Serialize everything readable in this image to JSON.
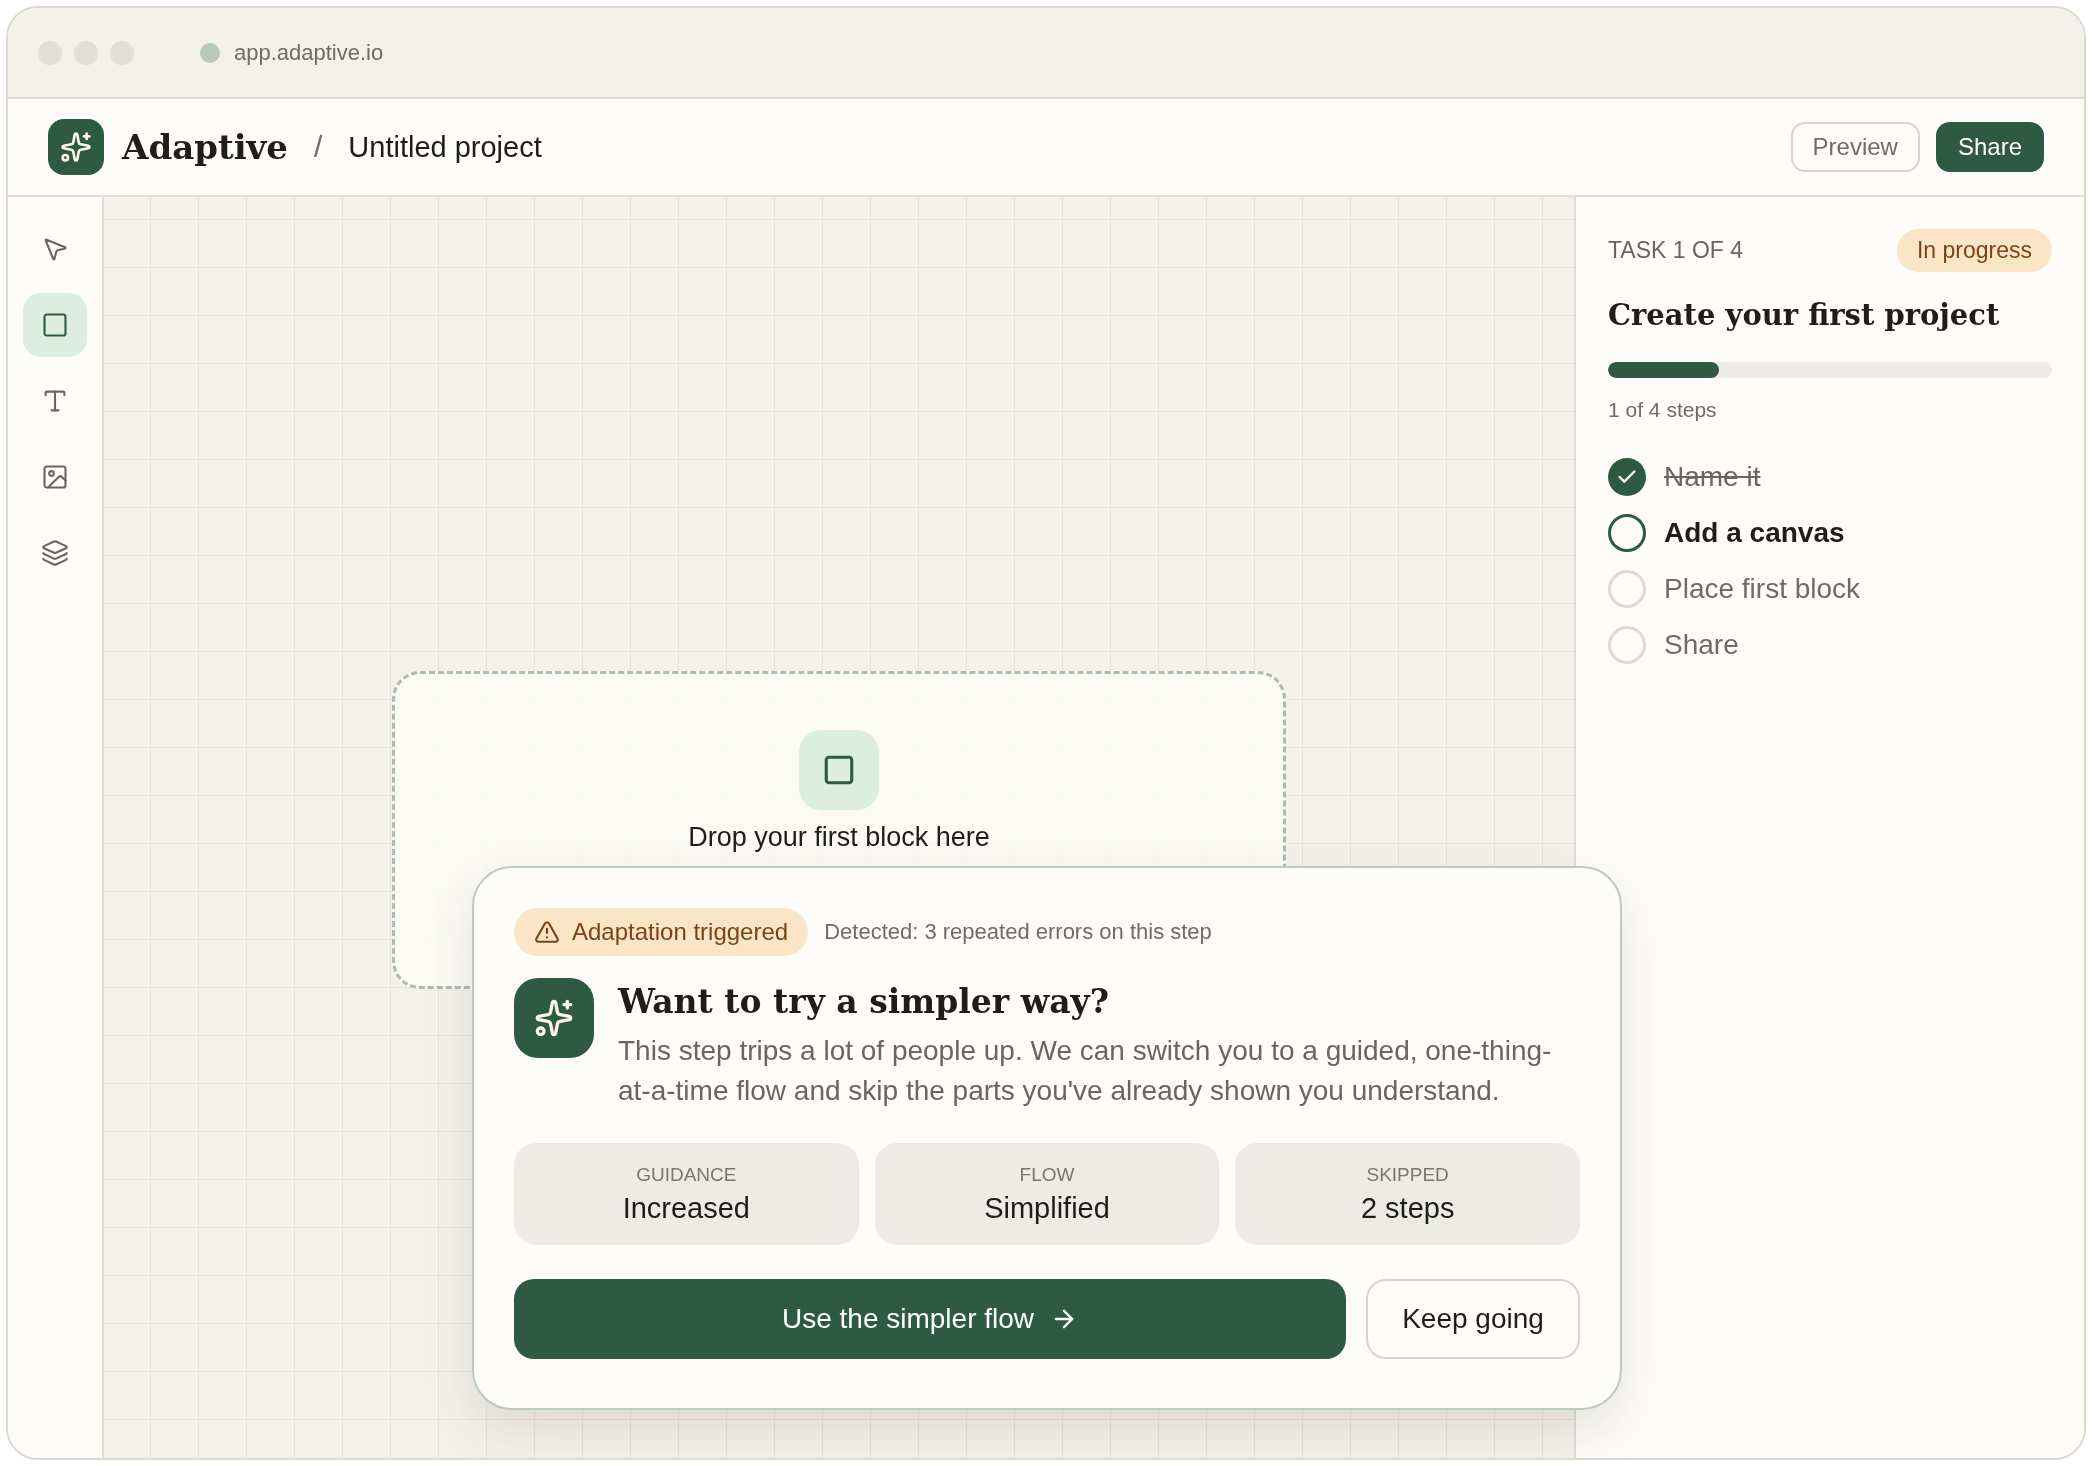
{
  "browser": {
    "url": "app.adaptive.io"
  },
  "header": {
    "brand": "Adaptive",
    "separator": "/",
    "project": "Untitled project",
    "buttons": [
      {
        "label": "Preview",
        "kind": "secondary"
      },
      {
        "label": "Share",
        "kind": "primary"
      }
    ]
  },
  "tools": [
    {
      "kind": "pointer",
      "selected": false
    },
    {
      "kind": "rectangle",
      "selected": true
    },
    {
      "kind": "text",
      "selected": false
    },
    {
      "kind": "image",
      "selected": false
    },
    {
      "kind": "layers",
      "selected": false
    }
  ],
  "canvas": {
    "drop_zone": {
      "label": "Drop your first block here"
    }
  },
  "task_panel": {
    "counter": "TASK 1 OF 4",
    "status": "In progress",
    "title": "Create your first project",
    "level": 0.25,
    "steps_label": "1 of 4 steps",
    "steps": [
      {
        "label": "Name it",
        "kind": "done"
      },
      {
        "label": "Add a canvas",
        "kind": "current"
      },
      {
        "label": "Place first block",
        "kind": "pending"
      },
      {
        "label": "Share",
        "kind": "pending"
      }
    ]
  },
  "prompt": {
    "badge": "Adaptation triggered",
    "detected": "Detected: 3 repeated errors on this step",
    "title": "Want to try a simpler way?",
    "body": "This step trips a lot of people up. We can switch you to a guided, one-thing-at-a-time flow and skip the parts you've already shown you understand.",
    "stats": [
      {
        "label": "GUIDANCE",
        "value": "Increased"
      },
      {
        "label": "FLOW",
        "value": "Simplified"
      },
      {
        "label": "SKIPPED",
        "value": "2 steps"
      }
    ],
    "buttons": [
      {
        "label": "Use the simpler flow",
        "kind": "primary"
      },
      {
        "label": "Keep going",
        "kind": "secondary"
      }
    ]
  }
}
